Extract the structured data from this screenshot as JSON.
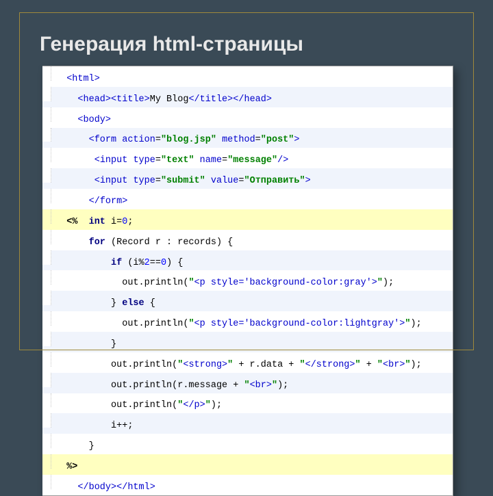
{
  "slide": {
    "title": "Генерация html-страницы"
  },
  "code": {
    "l1": "<html>",
    "l2a": "<head><title>",
    "l2b": "My Blog",
    "l2c": "</title></head>",
    "l3": "<body>",
    "l4a": "<form ",
    "l4b": "action",
    "l4eq1": "=",
    "l4v1": "\"blog.jsp\" ",
    "l4c": "method",
    "l4eq2": "=",
    "l4v2": "\"post\"",
    "l4d": ">",
    "l5a": "<input ",
    "l5b": "type",
    "l5eq1": "=",
    "l5v1": "\"text\" ",
    "l5c": "name",
    "l5eq2": "=",
    "l5v2": "\"message\"",
    "l5d": "/>",
    "l6a": "<input ",
    "l6b": "type",
    "l6eq1": "=",
    "l6v1": "\"submit\" ",
    "l6c": "value",
    "l6eq2": "=",
    "l6v2": "\"Отправить\"",
    "l6d": ">",
    "l7": "</form>",
    "l8a": "<%",
    "l8b": "int ",
    "l8c": "i=",
    "l8d": "0",
    "l8e": ";",
    "l9a": "for ",
    "l9b": "(Record r : records) {",
    "l10a": "if ",
    "l10b": "(i%",
    "l10c": "2",
    "l10d": "==",
    "l10e": "0",
    "l10f": ") {",
    "l11a": "out.println(",
    "l11b": "\"",
    "l11c": "<p style='background-color:gray'>",
    "l11d": "\"",
    "l11e": ");",
    "l12a": "} ",
    "l12b": "else ",
    "l12c": "{",
    "l13a": "out.println(",
    "l13b": "\"",
    "l13c": "<p style='background-color:lightgray'>",
    "l13d": "\"",
    "l13e": ");",
    "l14": "}",
    "l15a": "out.println(",
    "l15b": "\"",
    "l15c": "<strong>",
    "l15d": "\" ",
    "l15e": "+ r.data + ",
    "l15f": "\"",
    "l15g": "</strong>",
    "l15h": "\" ",
    "l15i": "+ ",
    "l15j": "\"",
    "l15k": "<br>",
    "l15l": "\"",
    "l15m": ");",
    "l16a": "out.println(r.message + ",
    "l16b": "\"",
    "l16c": "<br>",
    "l16d": "\"",
    "l16e": ");",
    "l17a": "out.println(",
    "l17b": "\"",
    "l17c": "</p>",
    "l17d": "\"",
    "l17e": ");",
    "l18": "i++;",
    "l19": "}",
    "l20": "%>",
    "l21": "</body></html>"
  }
}
